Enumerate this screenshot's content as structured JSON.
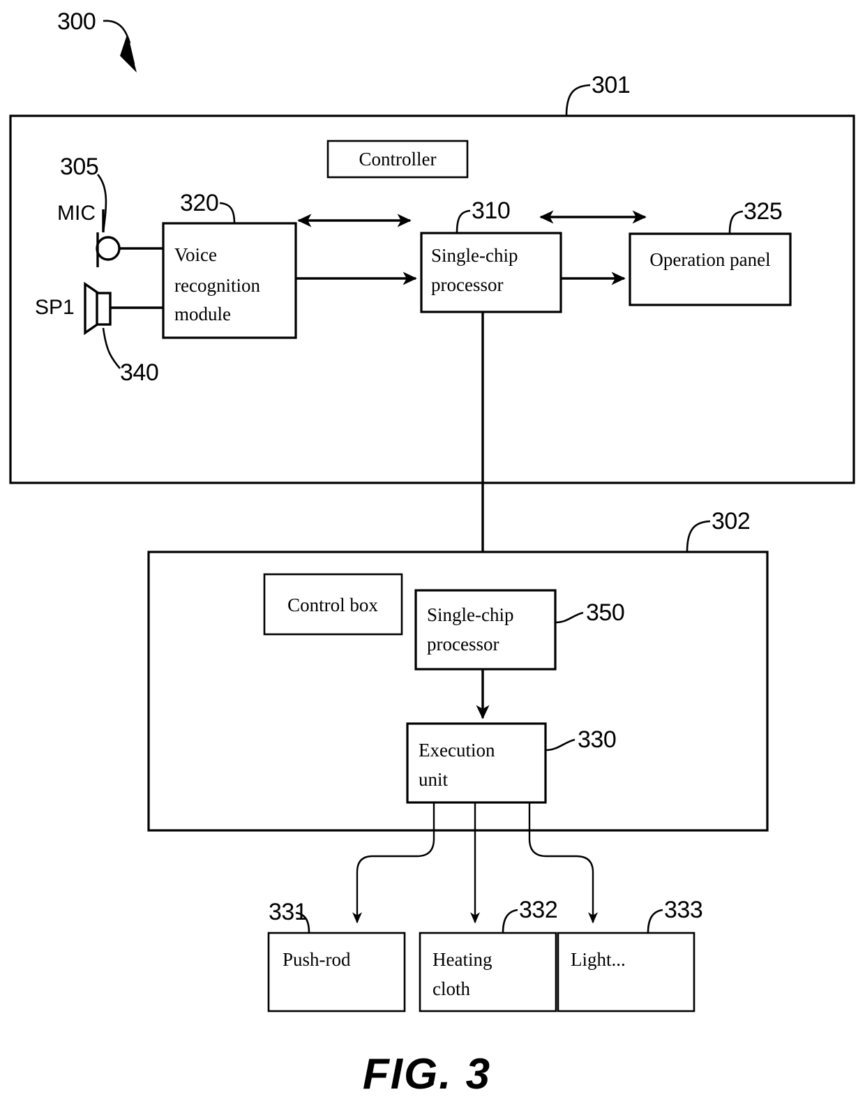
{
  "figure": {
    "caption": "FIG.  3",
    "system_ref": "300"
  },
  "sections": [
    {
      "ref": "301",
      "title": "Controller",
      "name": "controller-section"
    },
    {
      "ref": "302",
      "title": "Control box",
      "name": "control-box-section"
    }
  ],
  "terminals": [
    {
      "label": "MIC",
      "ref": "305",
      "name": "microphone"
    },
    {
      "label": "SP1",
      "ref": "340",
      "name": "speaker"
    }
  ],
  "blocks": [
    {
      "id": "voice",
      "ref": "320",
      "lines": [
        "Voice",
        "recognition",
        "module"
      ]
    },
    {
      "id": "mcu_controller",
      "ref": "310",
      "lines": [
        "Single-chip",
        "processor"
      ]
    },
    {
      "id": "operation_panel",
      "ref": "325",
      "lines": [
        "Operation panel"
      ]
    },
    {
      "id": "mcu_controlbox",
      "ref": "350",
      "lines": [
        "Single-chip",
        "processor"
      ]
    },
    {
      "id": "execution_unit",
      "ref": "330",
      "lines": [
        "Execution",
        "unit"
      ]
    },
    {
      "id": "push_rod",
      "ref": "331",
      "lines": [
        "Push-rod"
      ]
    },
    {
      "id": "heating_cloth",
      "ref": "332",
      "lines": [
        "Heating",
        "cloth"
      ]
    },
    {
      "id": "light",
      "ref": "333",
      "lines": [
        "Light..."
      ]
    }
  ],
  "labels": {
    "controller_title": "Controller",
    "control_box_title": "Control box",
    "voice_l1": "Voice",
    "voice_l2": "recognition",
    "voice_l3": "module",
    "mcu1_l1": "Single-chip",
    "mcu1_l2": "processor",
    "operation_panel": "Operation panel",
    "mcu2_l1": "Single-chip",
    "mcu2_l2": "processor",
    "exec_l1": "Execution",
    "exec_l2": "unit",
    "push_rod": "Push-rod",
    "heating_l1": "Heating",
    "heating_l2": "cloth",
    "light": "Light...",
    "mic": "MIC",
    "sp1": "SP1"
  },
  "refs": {
    "r300": "300",
    "r301": "301",
    "r302": "302",
    "r305": "305",
    "r310": "310",
    "r320": "320",
    "r325": "325",
    "r330": "330",
    "r331": "331",
    "r332": "332",
    "r333": "333",
    "r340": "340",
    "r350": "350"
  },
  "colors": {
    "stroke": "#000000",
    "background": "#ffffff"
  }
}
